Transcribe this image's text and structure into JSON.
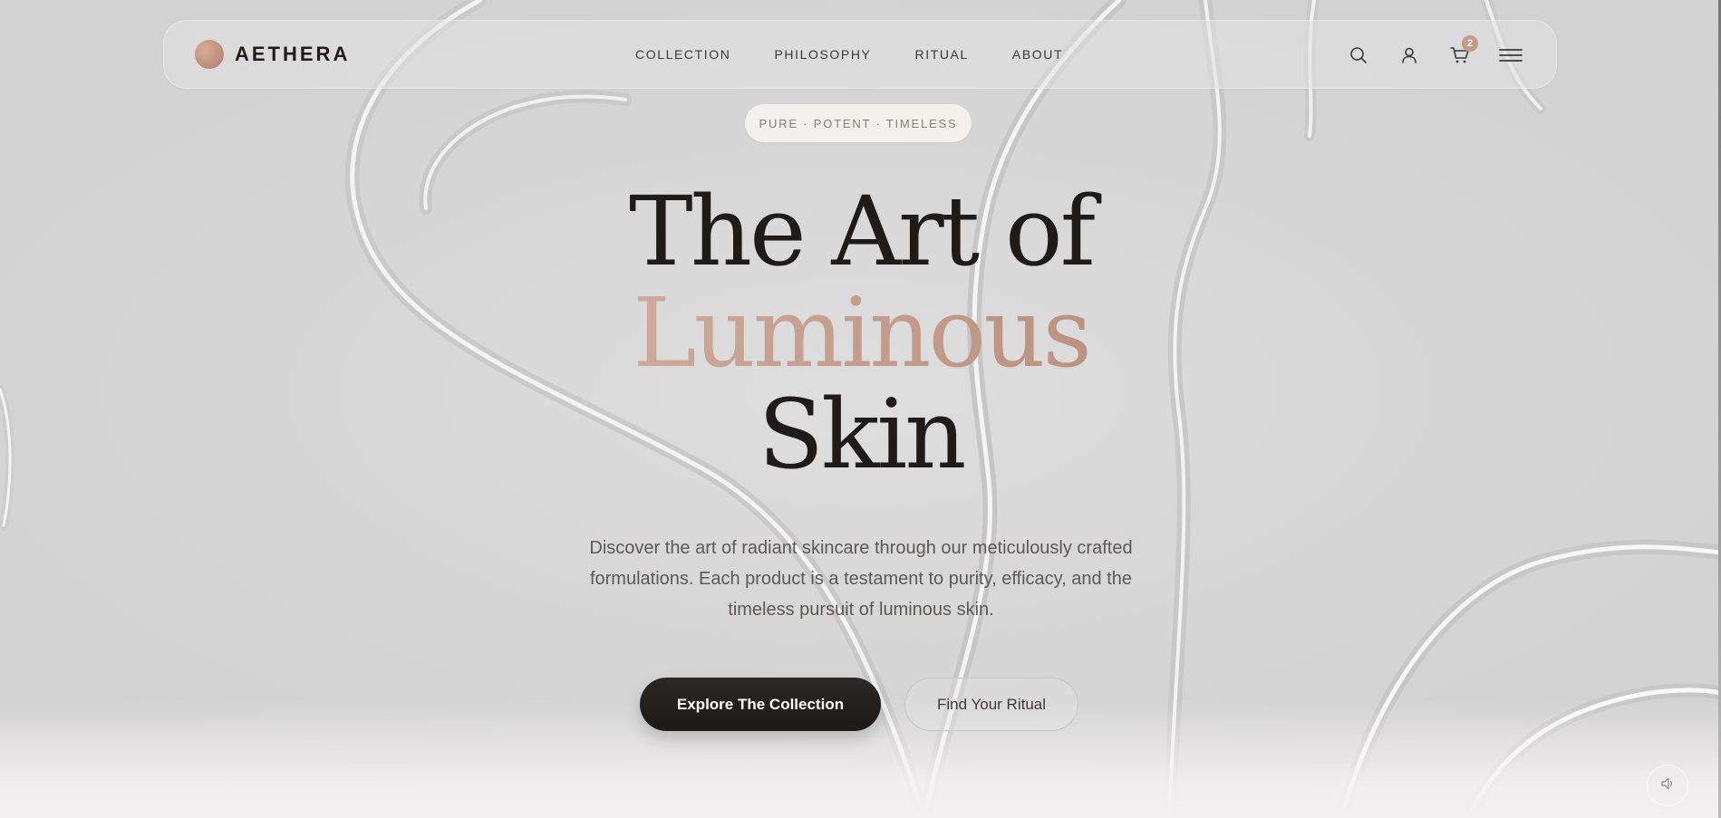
{
  "brand": {
    "name": "AETHERA"
  },
  "nav": {
    "links": [
      {
        "label": "COLLECTION"
      },
      {
        "label": "PHILOSOPHY"
      },
      {
        "label": "RITUAL"
      },
      {
        "label": "ABOUT"
      }
    ],
    "icons": [
      "search-icon",
      "user-icon",
      "cart-icon",
      "menu-icon"
    ],
    "cart_count": "2"
  },
  "hero": {
    "tagline": "PURE · POTENT · TIMELESS",
    "headline": {
      "line1": "The Art of",
      "line2": "Luminous",
      "line3": "Skin"
    },
    "description": "Discover the art of radiant skincare through our meticulously crafted formulations. Each product is a testament to purity, efficacy, and the timeless pursuit of luminous skin.",
    "primary_cta": "Explore The Collection",
    "secondary_cta": "Find Your Ritual"
  },
  "sound_toggle": {
    "icon": "speaker-icon"
  },
  "colors": {
    "accent": "#c49b86",
    "text_dark": "#1e1b19",
    "background": "#d9d9d9"
  }
}
